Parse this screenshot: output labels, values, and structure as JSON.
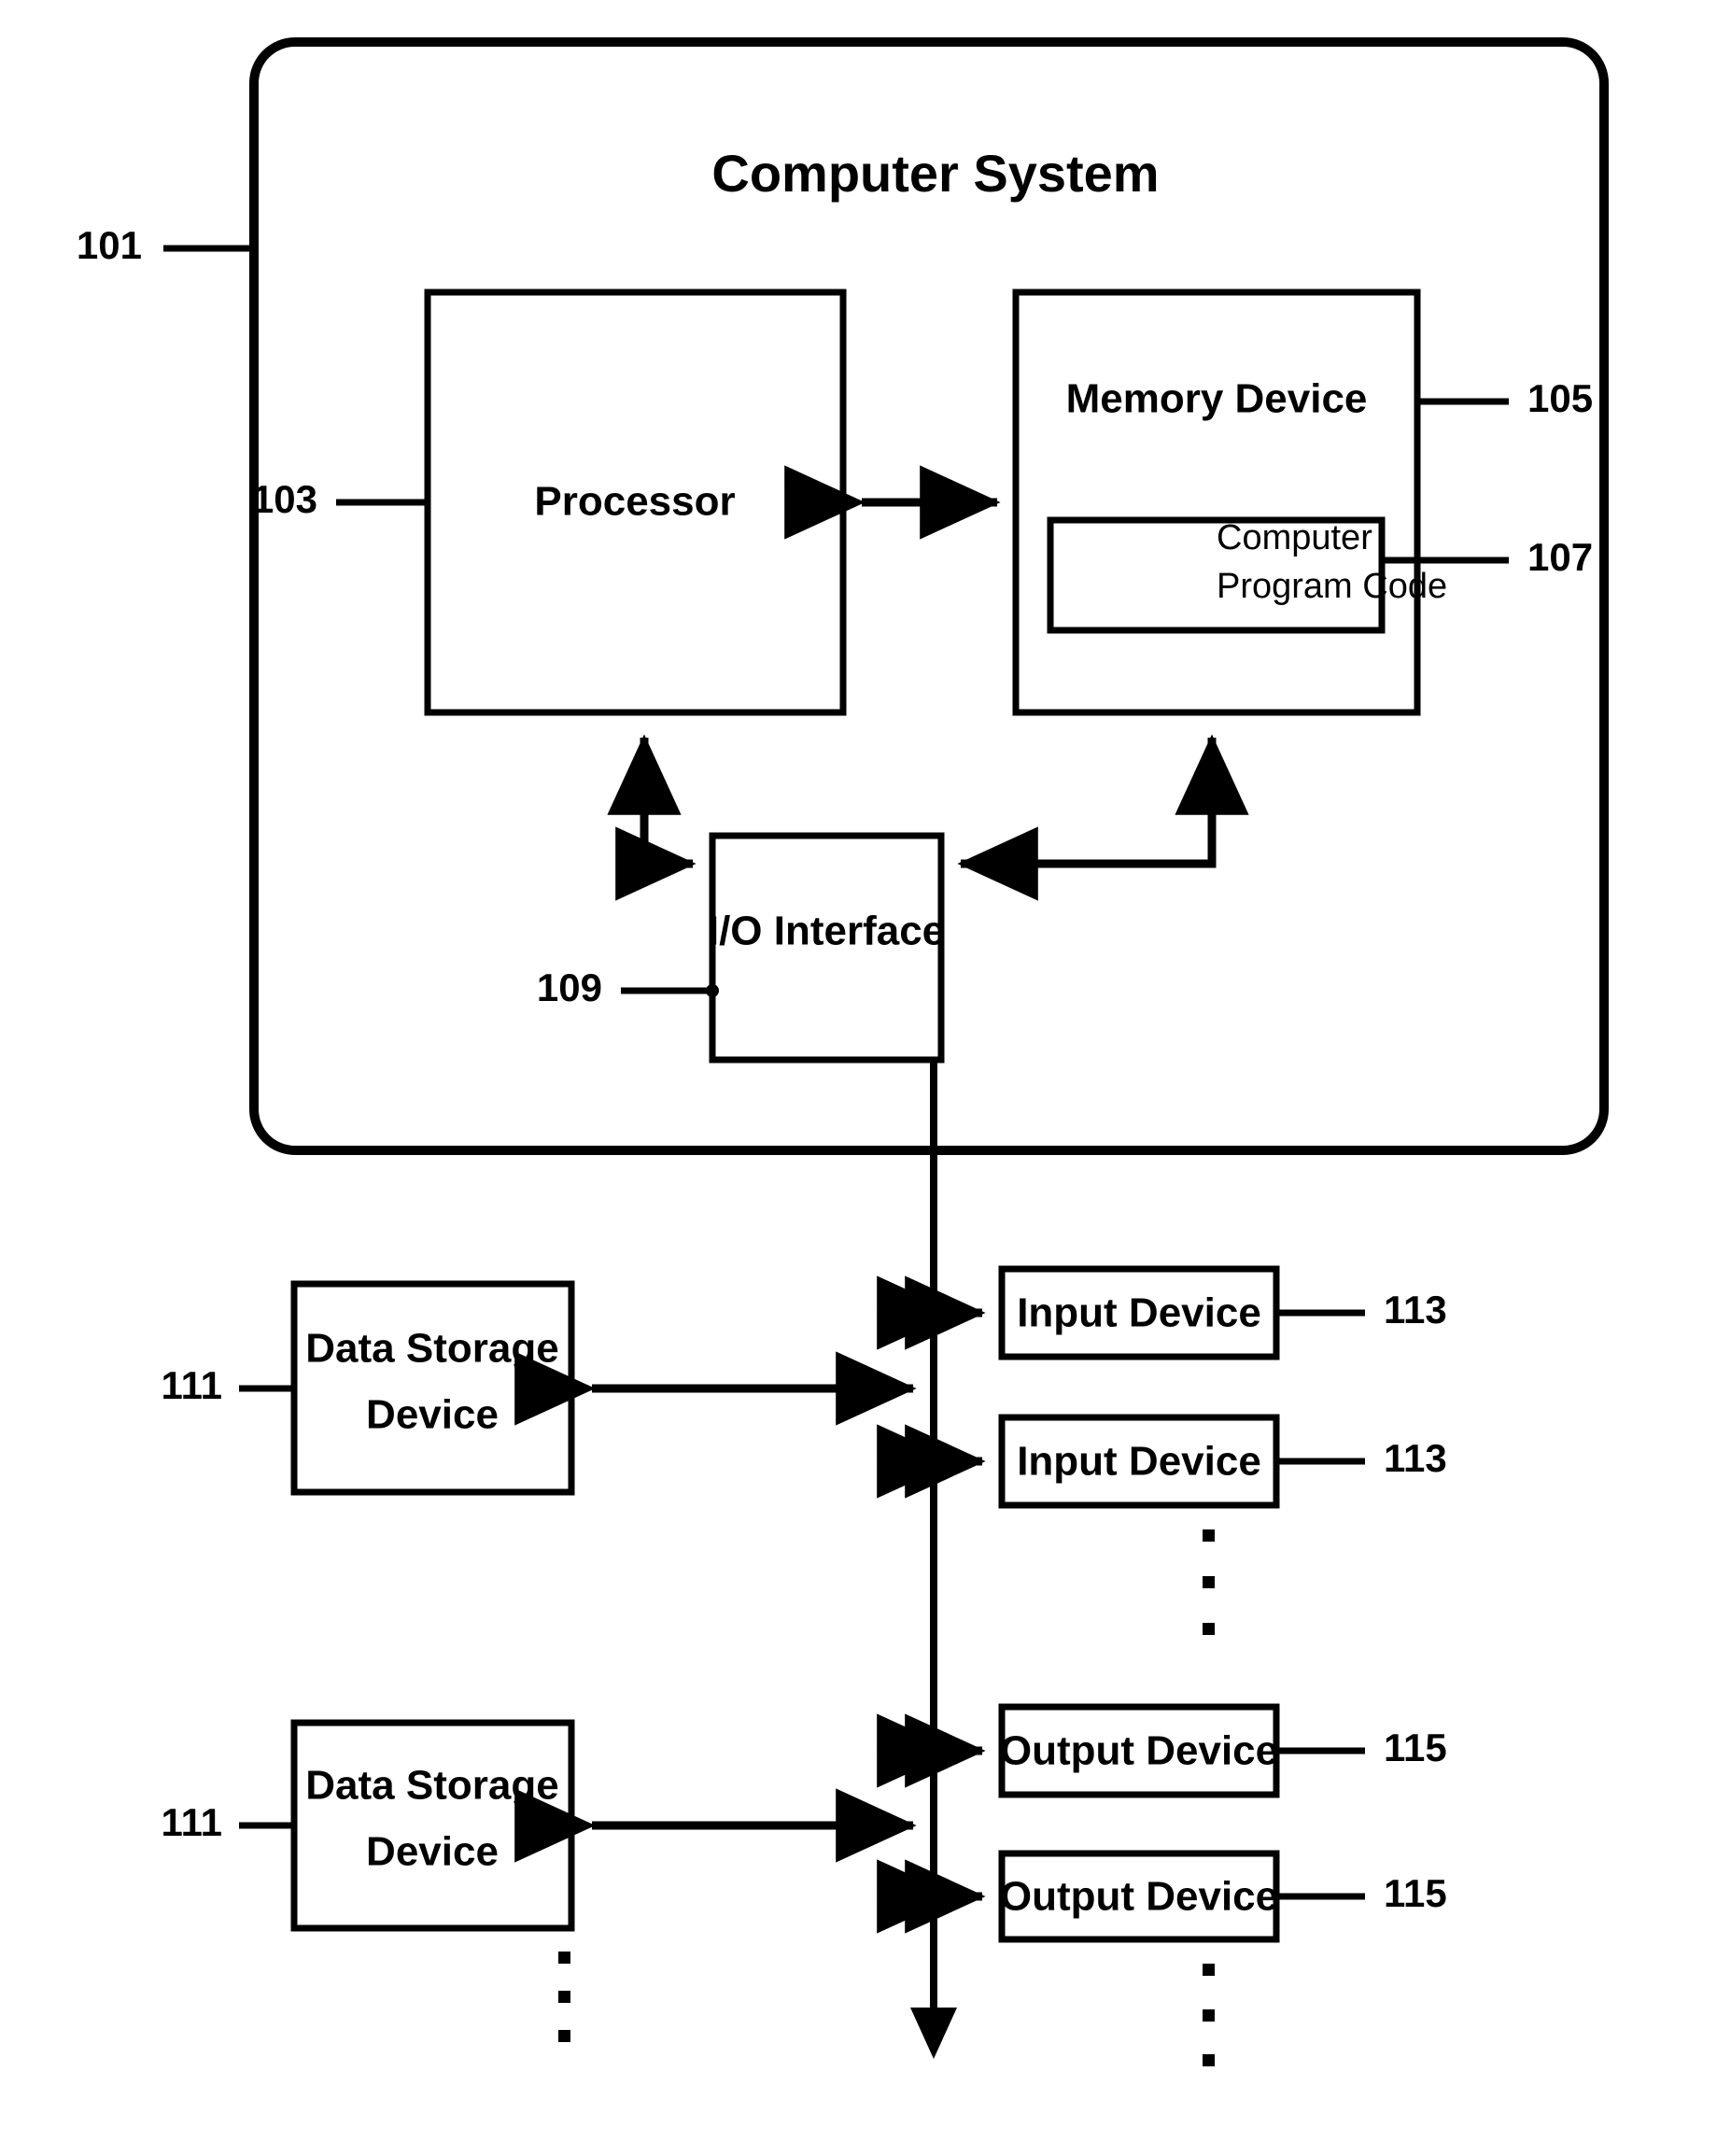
{
  "figure": {
    "title": "Computer System",
    "kind": "patent-block-diagram"
  },
  "blocks": {
    "computer_system": {
      "label": "Computer System",
      "ref": "101"
    },
    "processor": {
      "label": "Processor",
      "ref": "103"
    },
    "memory_device": {
      "label": "Memory Device",
      "ref": "105"
    },
    "computer_program_code": {
      "label_line1": "Computer",
      "label_line2": "Program Code",
      "ref": "107"
    },
    "io_interface": {
      "label": "I/O Interface",
      "ref": "109"
    },
    "data_storage_device_1": {
      "label_line1": "Data Storage",
      "label_line2": "Device",
      "ref": "111"
    },
    "data_storage_device_2": {
      "label_line1": "Data Storage",
      "label_line2": "Device",
      "ref": "111"
    },
    "input_device_1": {
      "label": "Input Device",
      "ref": "113"
    },
    "input_device_2": {
      "label": "Input Device",
      "ref": "113"
    },
    "output_device_1": {
      "label": "Output Device",
      "ref": "115"
    },
    "output_device_2": {
      "label": "Output Device",
      "ref": "115"
    }
  },
  "reference_numerals": {
    "n101": "101",
    "n103": "103",
    "n105": "105",
    "n107": "107",
    "n109": "109",
    "n111_a": "111",
    "n111_b": "111",
    "n113_a": "113",
    "n113_b": "113",
    "n115_a": "115",
    "n115_b": "115"
  },
  "ellipses": {
    "input_devices": "· · ·",
    "output_devices": "· · ·",
    "data_storage_devices": "· · ·"
  },
  "colors": {
    "ink": "#000000",
    "paper": "#ffffff"
  }
}
